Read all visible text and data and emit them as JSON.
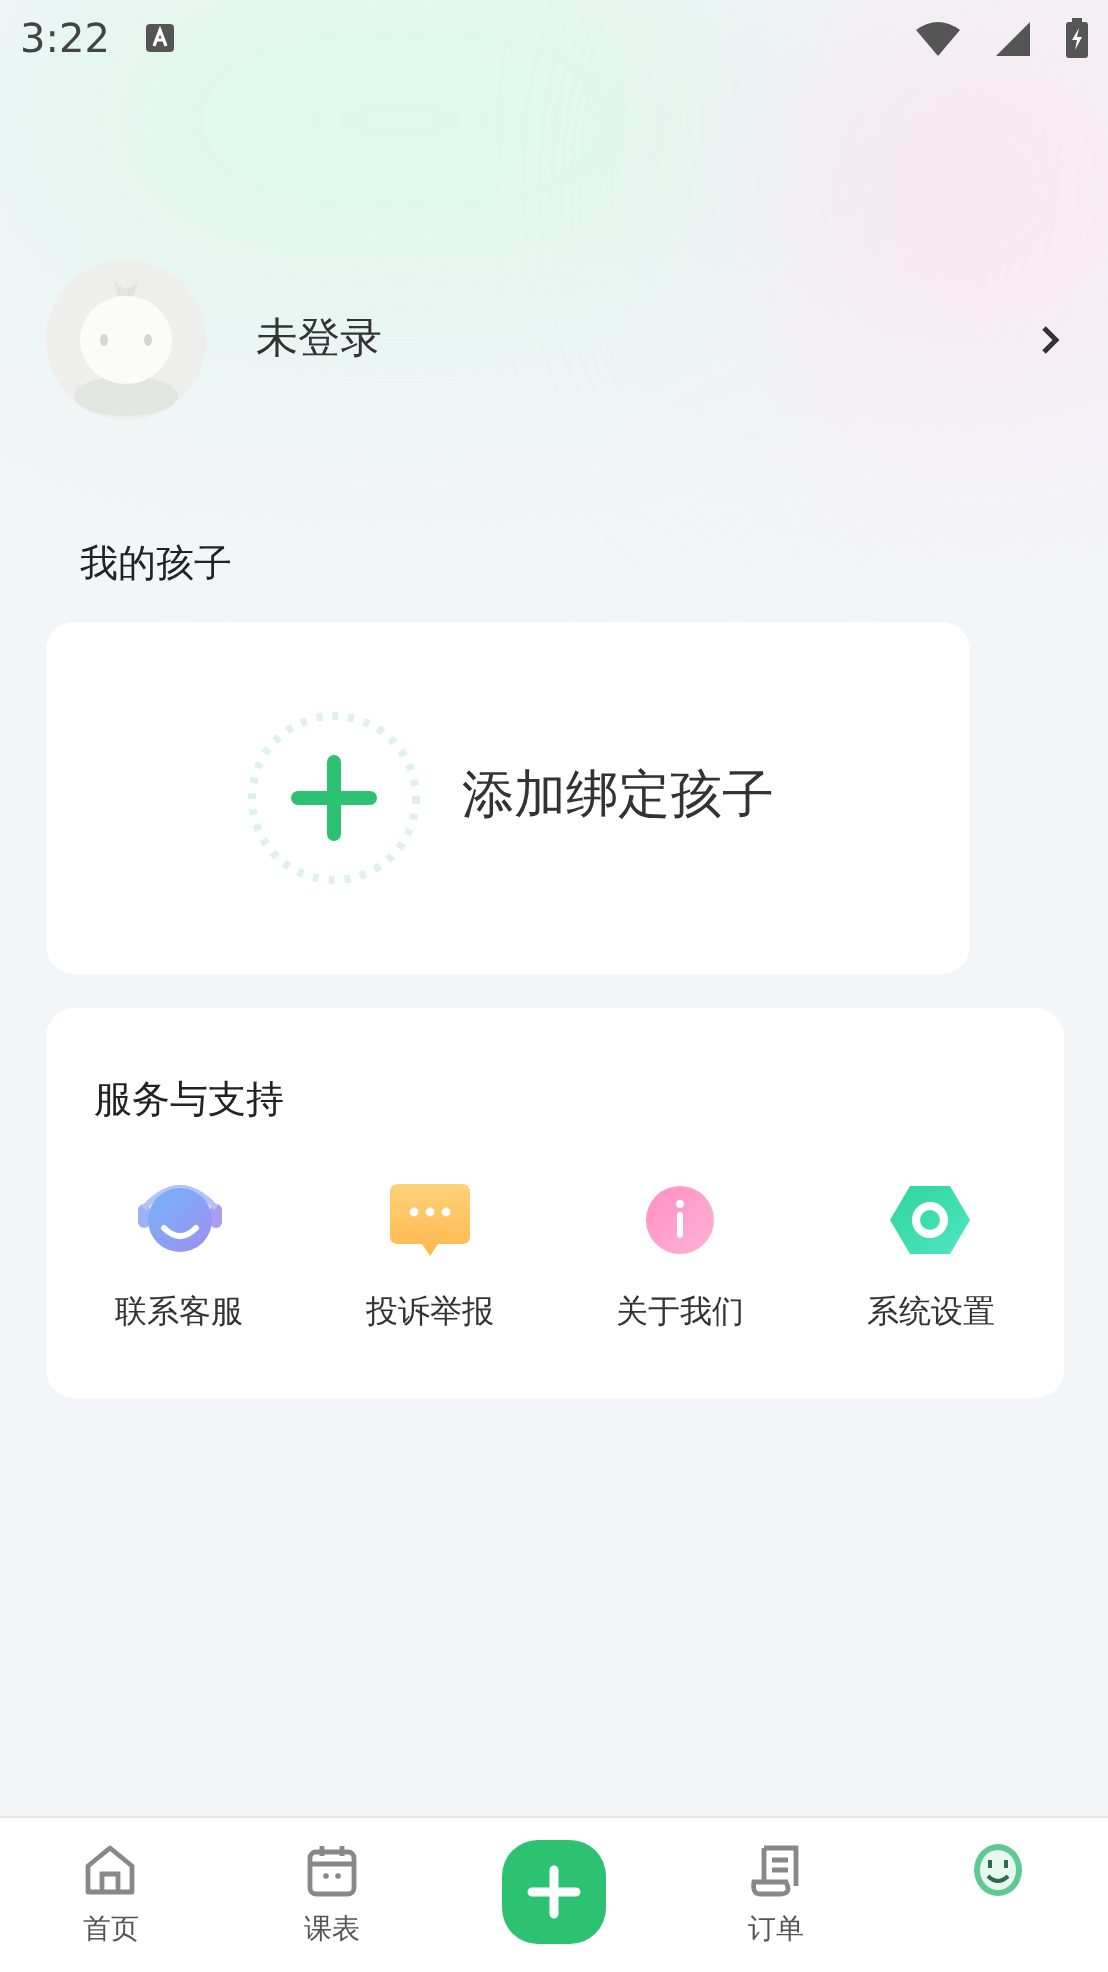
{
  "status_bar": {
    "time": "3:22"
  },
  "profile": {
    "name": "未登录"
  },
  "children_section": {
    "title": "我的孩子",
    "add_label": "添加绑定孩子"
  },
  "services": {
    "title": "服务与支持",
    "items": [
      {
        "kind": "headset",
        "label": "联系客服"
      },
      {
        "kind": "chat",
        "label": "投诉举报"
      },
      {
        "kind": "info",
        "label": "关于我们"
      },
      {
        "kind": "settings",
        "label": "系统设置"
      }
    ]
  },
  "tabs": [
    {
      "kind": "home",
      "label": "首页",
      "selected": false
    },
    {
      "kind": "calendar",
      "label": "课表",
      "selected": false
    },
    {
      "kind": "add"
    },
    {
      "kind": "orders",
      "label": "订单",
      "selected": false
    },
    {
      "kind": "profile",
      "selected": true
    }
  ]
}
